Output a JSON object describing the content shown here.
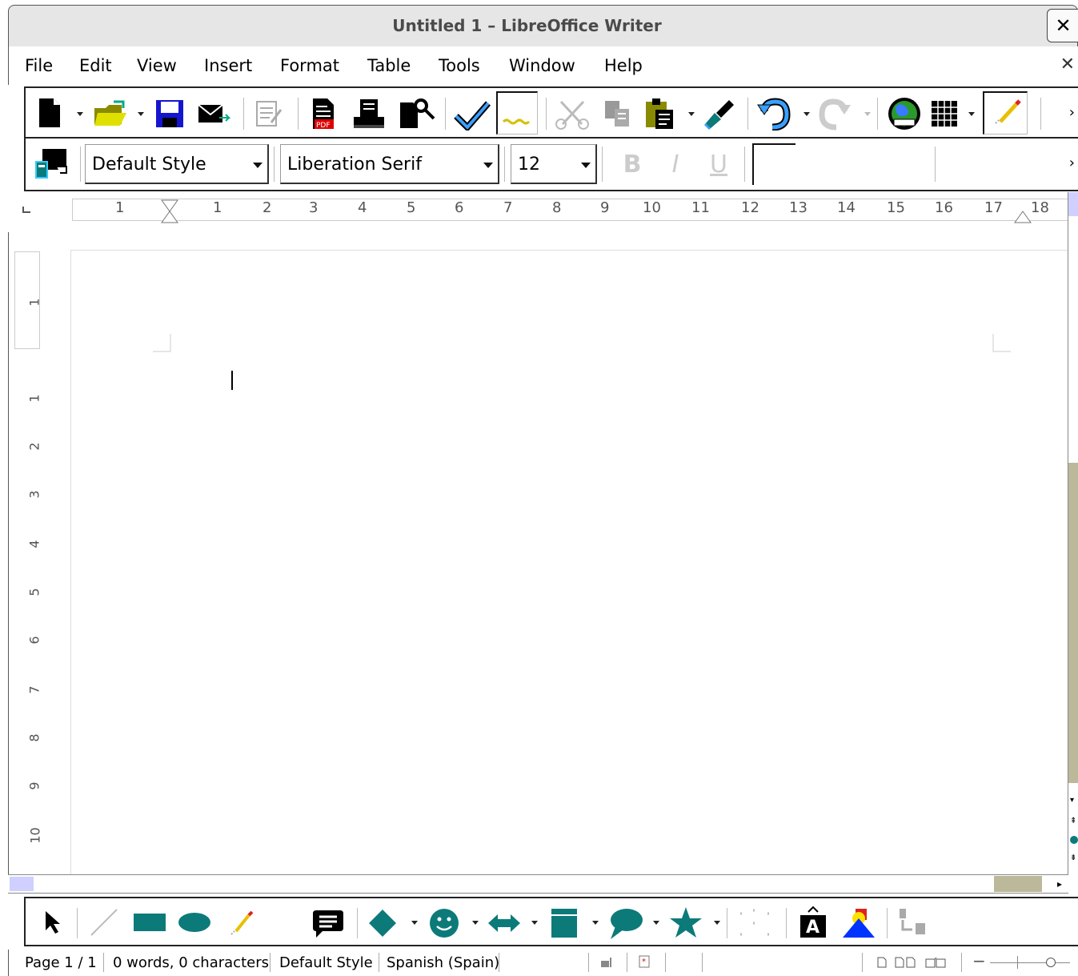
{
  "window": {
    "title": "Untitled 1 – LibreOffice Writer",
    "close_glyph": "✕"
  },
  "menubar": {
    "items": [
      {
        "label": "File"
      },
      {
        "label": "Edit"
      },
      {
        "label": "View"
      },
      {
        "label": "Insert"
      },
      {
        "label": "Format"
      },
      {
        "label": "Table"
      },
      {
        "label": "Tools"
      },
      {
        "label": "Window"
      },
      {
        "label": "Help"
      }
    ],
    "doc_close_glyph": "✕"
  },
  "standard_toolbar": {
    "icons": [
      "new-document-icon",
      "open-folder-icon",
      "save-icon",
      "email-icon",
      "edit-mode-icon",
      "export-pdf-icon",
      "print-icon",
      "print-preview-icon",
      "spellcheck-icon",
      "autospell-icon",
      "cut-icon",
      "copy-icon",
      "paste-icon",
      "clone-formatting-icon",
      "undo-icon",
      "redo-icon",
      "navigator-icon",
      "table-icon",
      "show-draw-functions-icon"
    ],
    "more_glyph": "›"
  },
  "formatting_toolbar": {
    "paragraph_style": "Default Style",
    "font_name": "Liberation Serif",
    "font_size": "12",
    "bold_glyph": "B",
    "italic_glyph": "I",
    "underline_glyph": "U",
    "more_glyph": "›"
  },
  "ruler": {
    "h_labels": [
      "1",
      "1",
      "2",
      "3",
      "4",
      "5",
      "6",
      "7",
      "8",
      "9",
      "10",
      "11",
      "12",
      "13",
      "14",
      "15",
      "16",
      "17",
      "18"
    ],
    "v_labels": [
      "1",
      "1",
      "2",
      "3",
      "4",
      "5",
      "6",
      "7",
      "8",
      "9",
      "10"
    ]
  },
  "statusbar": {
    "page": "Page 1 / 1",
    "words": "0 words, 0 characters",
    "style": "Default Style",
    "language": "Spanish (Spain)"
  },
  "colors": {
    "teal": "#0d7a7a",
    "scroll_thumb": "#bcb89a",
    "chrome": "#e6e6e6"
  }
}
